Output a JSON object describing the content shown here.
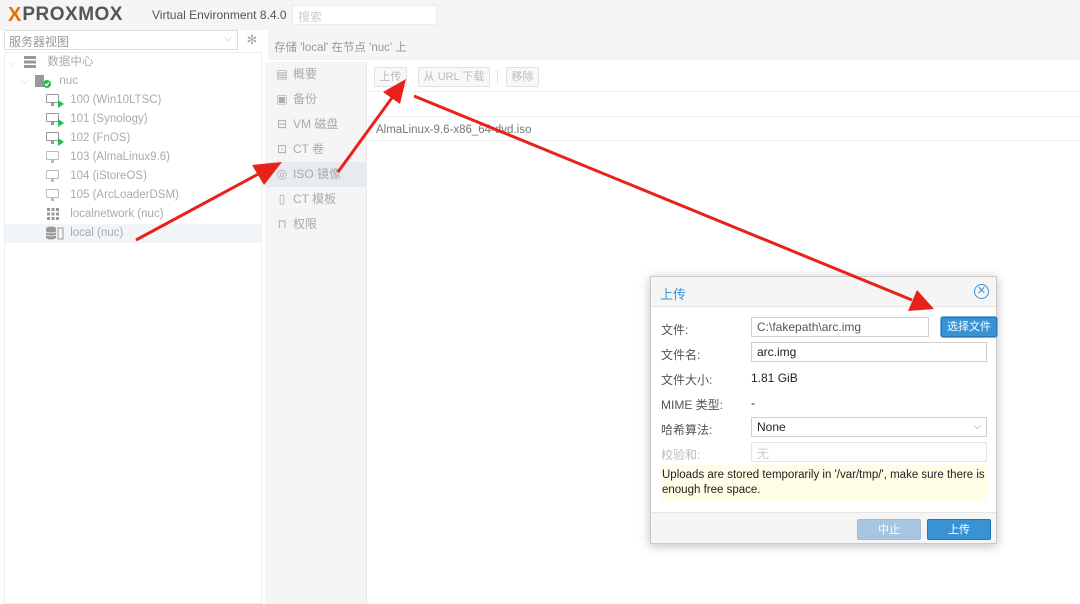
{
  "header": {
    "logo_x": "X",
    "logo_text": "PROXMOX",
    "product": "Virtual Environment 8.4.0",
    "search_placeholder": "搜索"
  },
  "tree": {
    "view": "服务器视图",
    "datacenter": "数据中心",
    "node": "nuc",
    "items": [
      {
        "label": "100 (Win10LTSC)",
        "running": true
      },
      {
        "label": "101 (Synology)",
        "running": true
      },
      {
        "label": "102 (FnOS)",
        "running": true
      },
      {
        "label": "103 (AlmaLinux9.6)",
        "running": false
      },
      {
        "label": "104 (iStoreOS)",
        "running": false
      },
      {
        "label": "105 (ArcLoaderDSM)",
        "running": false
      }
    ],
    "network": "localnetwork (nuc)",
    "storage": "local (nuc)"
  },
  "content": {
    "title": "存储 'local' 在节点 'nuc' 上",
    "nav": [
      {
        "label": "概要",
        "icon": "book-icon"
      },
      {
        "label": "备份",
        "icon": "save-icon"
      },
      {
        "label": "VM 磁盘",
        "icon": "hdd-icon"
      },
      {
        "label": "CT 卷",
        "icon": "ct-volume-icon"
      },
      {
        "label": "ISO 镜像",
        "icon": "disc-icon"
      },
      {
        "label": "CT 模板",
        "icon": "file-icon"
      },
      {
        "label": "权限",
        "icon": "unlock-icon"
      }
    ],
    "toolbar": {
      "upload": "上传",
      "download_url": "从 URL 下载",
      "remove": "移除"
    },
    "iso_row": "AlmaLinux-9.6-x86_64-dvd.iso"
  },
  "dialog": {
    "title": "上传",
    "file_label": "文件:",
    "file_value": "C:\\fakepath\\arc.img",
    "pick_file": "选择文件",
    "filename_label": "文件名:",
    "filename_value": "arc.img",
    "size_label": "文件大小:",
    "size_value": "1.81 GiB",
    "mime_label": "MIME 类型:",
    "mime_value": "-",
    "hash_label": "哈希算法:",
    "hash_value": "None",
    "checksum_label": "校验和:",
    "checksum_placeholder": "无",
    "notice": "Uploads are stored temporarily in '/var/tmp/', make sure there is enough free space.",
    "abort": "中止",
    "upload": "上传"
  },
  "colors": {
    "accent": "#3892d4",
    "arrow": "#e8221b",
    "running": "#21bf4b",
    "logo_orange": "#e57000"
  }
}
